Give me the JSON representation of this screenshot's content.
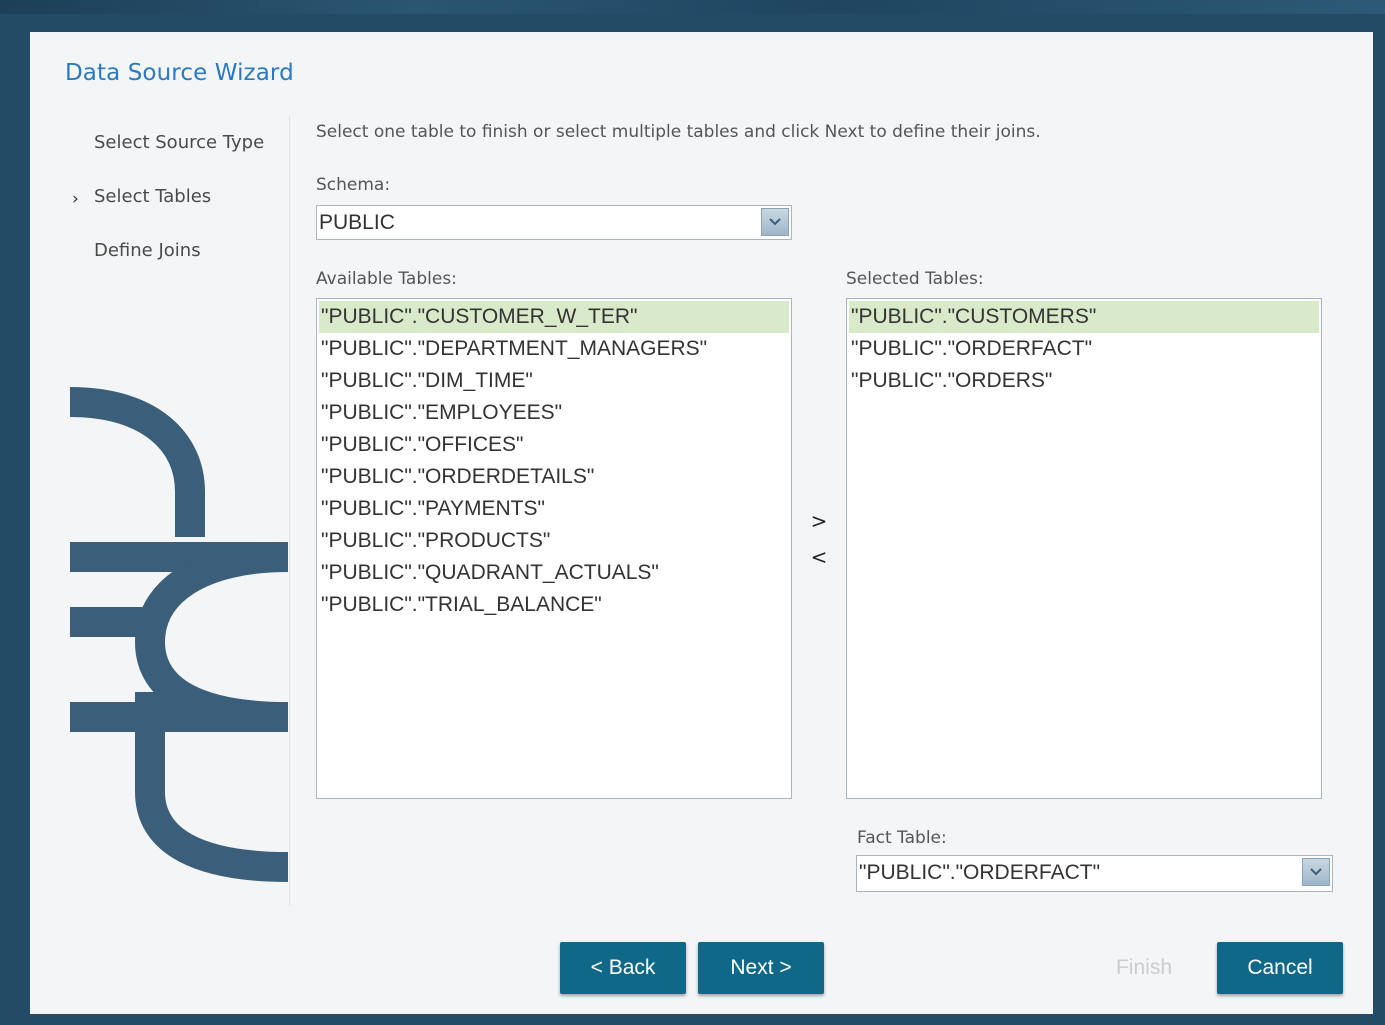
{
  "dialog": {
    "title": "Data Source Wizard"
  },
  "steps": [
    {
      "label": "Select Source Type",
      "current": false
    },
    {
      "label": "Select Tables",
      "current": true
    },
    {
      "label": "Define Joins",
      "current": false
    }
  ],
  "main": {
    "instructions": "Select one table to finish or select multiple tables and click Next to define their joins.",
    "schema": {
      "label": "Schema:",
      "value": "PUBLIC"
    },
    "available": {
      "label": "Available Tables:",
      "items": [
        "\"PUBLIC\".\"CUSTOMER_W_TER\"",
        "\"PUBLIC\".\"DEPARTMENT_MANAGERS\"",
        "\"PUBLIC\".\"DIM_TIME\"",
        "\"PUBLIC\".\"EMPLOYEES\"",
        "\"PUBLIC\".\"OFFICES\"",
        "\"PUBLIC\".\"ORDERDETAILS\"",
        "\"PUBLIC\".\"PAYMENTS\"",
        "\"PUBLIC\".\"PRODUCTS\"",
        "\"PUBLIC\".\"QUADRANT_ACTUALS\"",
        "\"PUBLIC\".\"TRIAL_BALANCE\""
      ],
      "selected_index": 0
    },
    "transfer": {
      "add": ">",
      "remove": "<"
    },
    "selected": {
      "label": "Selected Tables:",
      "items": [
        "\"PUBLIC\".\"CUSTOMERS\"",
        "\"PUBLIC\".\"ORDERFACT\"",
        "\"PUBLIC\".\"ORDERS\""
      ],
      "selected_index": 0
    },
    "fact_table": {
      "label": "Fact Table:",
      "value": "\"PUBLIC\".\"ORDERFACT\""
    }
  },
  "footer": {
    "back": "< Back",
    "next": "Next >",
    "finish": "Finish",
    "cancel": "Cancel"
  },
  "colors": {
    "backdrop": "#244b66",
    "title": "#2b7ac0",
    "button": "#0f6887",
    "selection": "#d9eacb",
    "logo": "#3b5f7a"
  }
}
